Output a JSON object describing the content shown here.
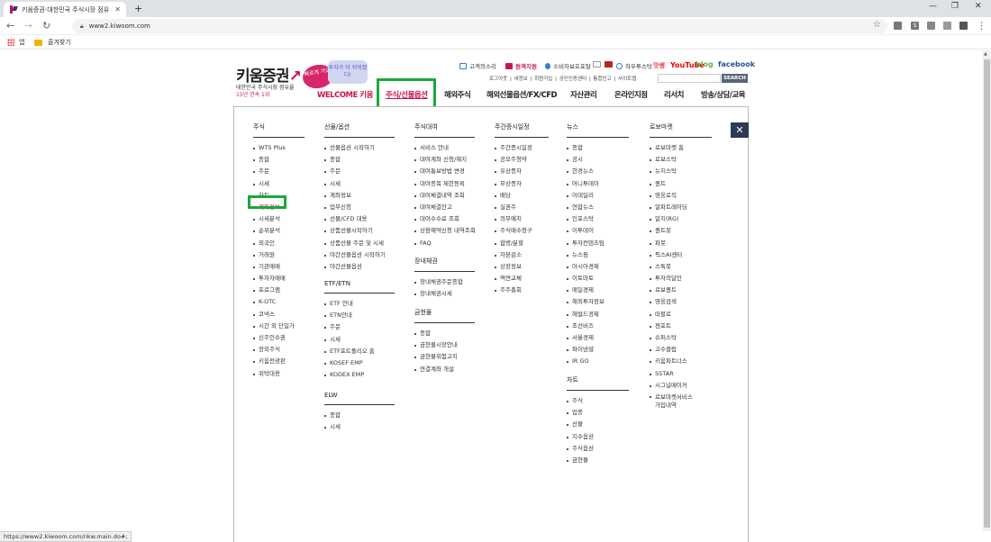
{
  "browser": {
    "tab_title": "키움증권-대한민국 주식시장 점유",
    "url": "www2.kiwoom.com",
    "bookmarks": {
      "apps": "앱",
      "favorites": "즐겨찾기"
    },
    "status_url": "https://www2.kiwoom.com/nkw.main.do#;"
  },
  "header": {
    "logo": "키움증권",
    "tagline1": "대한민국 주식시장 점유율",
    "tagline2": "15년 연속 1위",
    "bubble1": "빠르게 가요",
    "bubble2": "투자가 더 쉬워졌다!",
    "utils": {
      "customer": "고객의소리",
      "remote": "원격지원",
      "consumer": "소비자보호포탈",
      "hw": "하우투스탁",
      "ssdr": "맛쌩",
      "youtube": "YouTube",
      "blog": "blog",
      "facebook": "facebook"
    },
    "sublinks": "로그아웃 | 내정보 | 회원가입 | 공인인증센터 | 통합인고 | 사이트맵",
    "search_btn": "SEARCH"
  },
  "nav": {
    "welcome": "WELCOME 키움",
    "stock": "주식/선물옵션",
    "overseas": "해외주식",
    "fx": "해외선물옵션/FX/CFD",
    "asset": "자산관리",
    "online": "온라인지점",
    "research": "리서치",
    "consult": "방송/상담/교육"
  },
  "menu": {
    "close": "✕",
    "stock": {
      "title": "주식",
      "items": [
        "WTS Plus",
        "종합",
        "주문",
        "시세",
        "차트",
        "계좌정보",
        "시세분석",
        "순위분석",
        "외국인",
        "거래원",
        "기관매매",
        "투자자매매",
        "프로그램",
        "K-OTC",
        "코넥스",
        "시간 외 단일가",
        "신주인수권",
        "장외주식",
        "키움전광판",
        "위탁대용"
      ]
    },
    "futures": {
      "title": "선물/옵션",
      "items": [
        "선물옵션 시작하기",
        "종합",
        "주문",
        "시세",
        "계좌정보",
        "업무신청",
        "선물/CFD 대용",
        "상품선물시작하기",
        "상품선물 주문 및 시세",
        "야간선물옵션 시작하기",
        "야간선물옵션"
      ]
    },
    "etf": {
      "title": "ETF/ETN",
      "items": [
        "ETF 안내",
        "ETN안내",
        "주문",
        "시세",
        "ETF포트폴리오 홈",
        "KOSEF EMP",
        "KODEX EMP"
      ]
    },
    "elw": {
      "title": "ELW",
      "items": [
        "종합",
        "시세"
      ]
    },
    "loan": {
      "title": "주식대여",
      "items": [
        "서비스 안내",
        "대여계좌 신청/해지",
        "대여통보방법 변경",
        "대여종목 제한등록",
        "대여체결내역 조회",
        "대여체결잔고",
        "대여수수료 조회",
        "상환예약신청 내역조회",
        "FAQ"
      ]
    },
    "otc_bond": {
      "title": "장내채권",
      "items": [
        "장내채권주문종합",
        "장내채권시세"
      ]
    },
    "gold": {
      "title": "금현물",
      "items": [
        "종합",
        "금현물시장안내",
        "금현물위험고지",
        "연결계좌 개설"
      ]
    },
    "calendar": {
      "title": "주간증시일정",
      "items": [
        "주간증시일정",
        "공모주청약",
        "유상증자",
        "무상증자",
        "배당",
        "실권주",
        "의무예치",
        "주식매수청구",
        "합병/분할",
        "자본감소",
        "상장정보",
        "액면교체",
        "주주총회"
      ]
    },
    "news": {
      "title": "뉴스",
      "items": [
        "종합",
        "공시",
        "한경뉴스",
        "머니투데이",
        "이데일리",
        "연합뉴스",
        "인포스탁",
        "이투데이",
        "투자컨텐츠팀",
        "뉴스핌",
        "아시아경제",
        "이토마토",
        "매일경제",
        "해외투자정보",
        "헤럴드경제",
        "조선비즈",
        "서울경제",
        "파이낸셜",
        "IR GO"
      ]
    },
    "chart": {
      "title": "차트",
      "items": [
        "주식",
        "업종",
        "선물",
        "지수옵션",
        "주식옵션",
        "금현물"
      ]
    },
    "robo": {
      "title": "로보마켓",
      "items": [
        "로보마켓 홈",
        "로보스탁",
        "뉴지스탁",
        "퀀트",
        "영웅로직",
        "알파트레이딩",
        "알지(RG)",
        "퀀트봇",
        "파봇",
        "픽스AI센터",
        "스톡봇",
        "투자의달인",
        "로보퀀트",
        "영웅검색",
        "따블로",
        "젠포트",
        "슈퍼스탁",
        "고수클럽",
        "키움파트너스",
        "SSTAR",
        "시그널메이커"
      ],
      "last_line1": "로보마켓서비스",
      "last_line2": "가입내역"
    }
  }
}
